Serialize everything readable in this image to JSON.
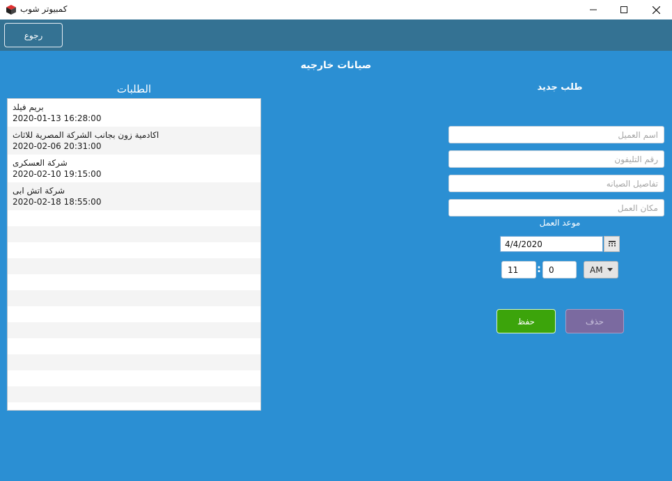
{
  "window": {
    "title": "كمبيوتر شوب",
    "icon": "cube-app-icon",
    "controls": [
      "minimize-icon",
      "maximize-icon",
      "close-icon"
    ]
  },
  "toolbar": {
    "back_label": "رجوع"
  },
  "page": {
    "title": "صيانات خارجيه"
  },
  "requests": {
    "title": "الطلبات",
    "items": [
      {
        "name": "بريم فيلد",
        "datetime": "2020-01-13 16:28:00"
      },
      {
        "name": "اكادمية زون بجانب الشركة المصرية للاثاث",
        "datetime": "2020-02-06 20:31:00"
      },
      {
        "name": "شركة العسكرى",
        "datetime": "2020-02-10 19:15:00"
      },
      {
        "name": "شركة اتش ابى",
        "datetime": "2020-02-18 18:55:00"
      }
    ]
  },
  "form": {
    "title": "طلب جديد",
    "customer_name_placeholder": "اسم العميل",
    "phone_placeholder": "رقم التليفون",
    "details_placeholder": "تفاصيل الصيانه",
    "location_placeholder": "مكان العمل",
    "appointment_label": "موعد العمل",
    "date_value": "4/4/2020",
    "hour_value": "11",
    "time_separator": ":",
    "minute_value": "0",
    "ampm_value": "AM",
    "save_label": "حفظ",
    "delete_label": "حذف"
  },
  "colors": {
    "background": "#2b8fd3",
    "toolbar": "#347293",
    "save": "#3ca40b",
    "delete": "#7b6aa0"
  }
}
